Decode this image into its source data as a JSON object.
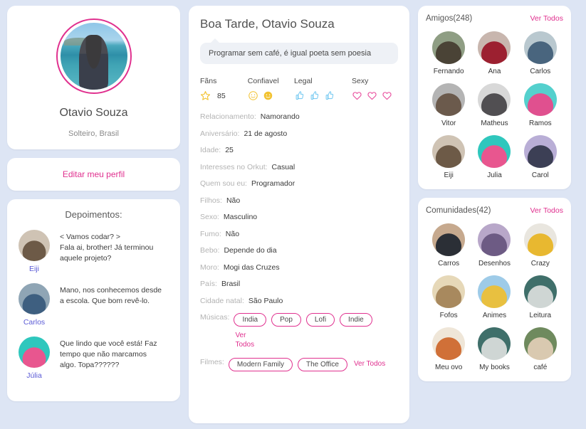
{
  "theme": {
    "page_bg": "#dde5f4",
    "card_bg": "#ffffff",
    "accent_pink": "#e0318f",
    "link_blue": "#5b5bd6",
    "label_grey": "#b3b3b3",
    "value_dark": "#3a3a3a"
  },
  "profile": {
    "name": "Otavio Souza",
    "status_line": "Solteiro, Brasil",
    "edit_label": "Editar meu perfil",
    "avatar_name": "profile-photo-beach"
  },
  "testimonials": {
    "title": "Depoimentos:",
    "items": [
      {
        "name": "Eiji",
        "text": "< Vamos codar? >\nFala ai, brother! Já terminou\naquele projeto?",
        "avatar_colors": [
          "#cfc3b4",
          "#6d5a47"
        ]
      },
      {
        "name": "Carlos",
        "text": "Mano, nos conhecemos desde\na escola. Que bom revê-lo.",
        "avatar_colors": [
          "#8fa5b5",
          "#3e5f80"
        ]
      },
      {
        "name": "Júlia",
        "text": "Que lindo que você está! Faz\ntempo que não marcamos\nalgo. Topa??????",
        "avatar_colors": [
          "#2fc7bd",
          "#e8568f"
        ]
      }
    ]
  },
  "main": {
    "greeting": "Boa Tarde, Otavio Souza",
    "status_message": "Programar sem café, é igual poeta sem poesia",
    "ratings": [
      {
        "label": "Fãns",
        "icon": "star-icon",
        "filled": 1,
        "total": 1,
        "count": "85",
        "color": "#f2c230"
      },
      {
        "label": "Confiavel",
        "icon": "smiley-icon",
        "filled": 2,
        "total": 2,
        "count": "",
        "color": "#f2c230"
      },
      {
        "label": "Legal",
        "icon": "thumbs-up-icon",
        "filled": 3,
        "total": 3,
        "count": "",
        "color": "#6ec6f0"
      },
      {
        "label": "Sexy",
        "icon": "heart-icon",
        "filled": 3,
        "total": 3,
        "count": "",
        "color": "#e8489a"
      }
    ],
    "details": [
      {
        "label": "Relacionamento:",
        "value": "Namorando"
      },
      {
        "label": "Aniversário:",
        "value": "21 de agosto"
      },
      {
        "label": "Idade:",
        "value": "25"
      },
      {
        "label": "Interesses no Orkut:",
        "value": "Casual"
      },
      {
        "label": "Quem sou eu:",
        "value": "Programador"
      },
      {
        "label": "Filhos:",
        "value": "Não"
      },
      {
        "label": "Sexo:",
        "value": "Masculino"
      },
      {
        "label": "Fumo:",
        "value": "Não"
      },
      {
        "label": "Bebo:",
        "value": "Depende do dia"
      },
      {
        "label": "Moro:",
        "value": "Mogi das Cruzes"
      },
      {
        "label": "País:",
        "value": "Brasil"
      },
      {
        "label": "Cidade natal:",
        "value": "São Paulo"
      }
    ],
    "musicas": {
      "label": "Músicas:",
      "tags": [
        "India",
        "Pop",
        "Lofi",
        "Indie"
      ],
      "see_all": "Ver Todos"
    },
    "filmes": {
      "label": "Filmes:",
      "tags": [
        "Modern Family",
        "The Office"
      ],
      "see_all": "Ver Todos"
    }
  },
  "friends": {
    "title": "Amigos(248)",
    "see_all": "Ver Todos",
    "items": [
      {
        "name": "Fernando",
        "colors": [
          "#8f9e84",
          "#4a4336"
        ]
      },
      {
        "name": "Ana",
        "colors": [
          "#c8b6ae",
          "#9c2030"
        ]
      },
      {
        "name": "Carlos",
        "colors": [
          "#b9c8cf",
          "#49657e"
        ]
      },
      {
        "name": "Vitor",
        "colors": [
          "#b4b4b4",
          "#6b5a4c"
        ]
      },
      {
        "name": "Matheus",
        "colors": [
          "#d8d8d8",
          "#514f52"
        ]
      },
      {
        "name": "Ramos",
        "colors": [
          "#54d0cd",
          "#e0508f"
        ]
      },
      {
        "name": "Eiji",
        "colors": [
          "#cfc3b4",
          "#6d5a47"
        ]
      },
      {
        "name": "Julia",
        "colors": [
          "#2fc7bd",
          "#e8568f"
        ]
      },
      {
        "name": "Carol",
        "colors": [
          "#b9aed6",
          "#3c3f55"
        ]
      }
    ]
  },
  "communities": {
    "title": "Comunidades(42)",
    "see_all": "Ver Todos",
    "items": [
      {
        "name": "Carros",
        "colors": [
          "#c6a98e",
          "#2b2f36"
        ]
      },
      {
        "name": "Desenhos",
        "colors": [
          "#b8a7c9",
          "#6d5b84"
        ]
      },
      {
        "name": "Crazy",
        "colors": [
          "#e9e6df",
          "#e8b830"
        ]
      },
      {
        "name": "Fofos",
        "colors": [
          "#e6d8b8",
          "#a8895e"
        ]
      },
      {
        "name": "Animes",
        "colors": [
          "#9ecbe8",
          "#e8c040"
        ]
      },
      {
        "name": "Leitura",
        "colors": [
          "#3f6f6a",
          "#cfd6d4"
        ]
      },
      {
        "name": "Meu ovo",
        "colors": [
          "#efe6d8",
          "#d07038"
        ]
      },
      {
        "name": "My books",
        "colors": [
          "#3f6f6a",
          "#cfd6d4"
        ]
      },
      {
        "name": "café",
        "colors": [
          "#6f8a5e",
          "#d9c9b0"
        ]
      }
    ]
  }
}
